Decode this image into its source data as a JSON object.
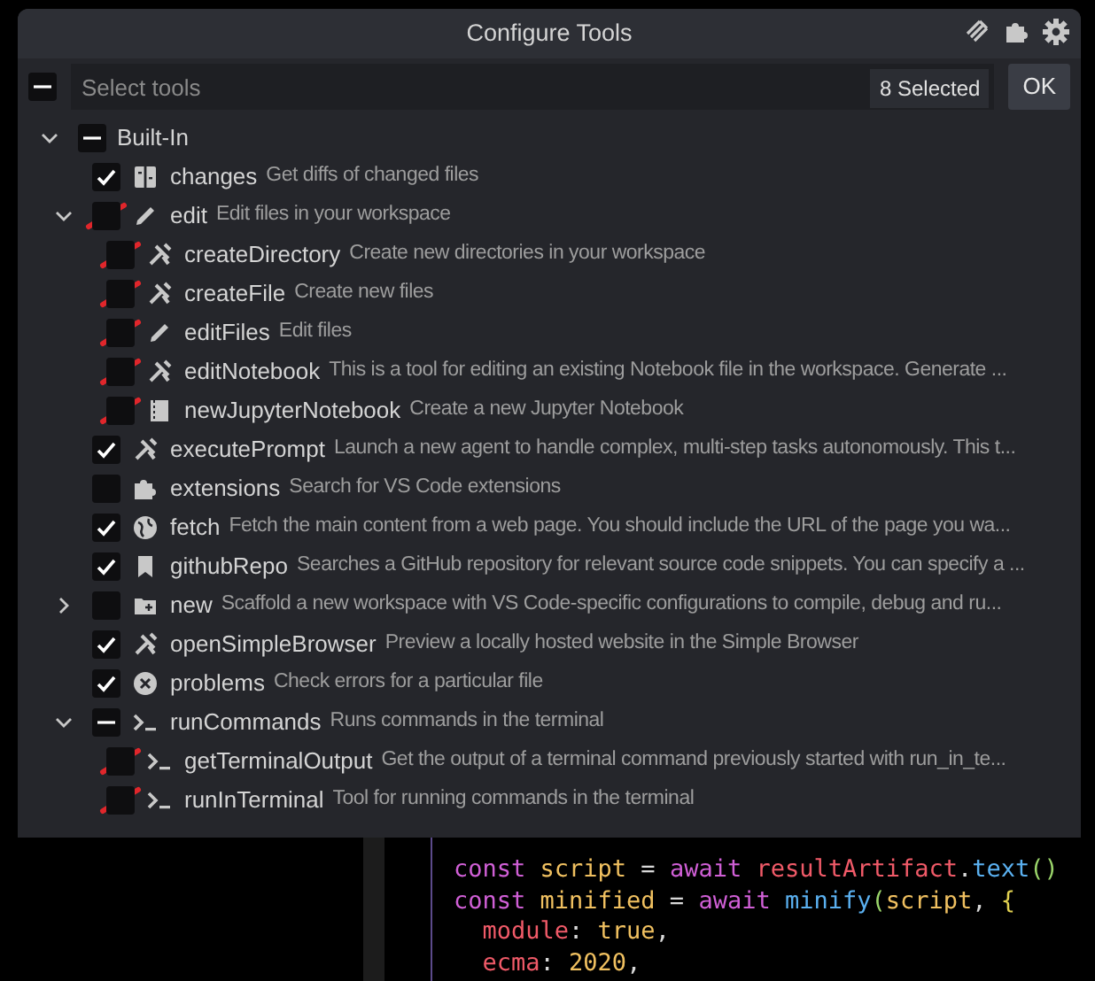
{
  "dialog": {
    "title": "Configure Tools",
    "search": {
      "placeholder": "Select tools",
      "mixed": true
    },
    "selected_count": "8 Selected",
    "ok_button": "OK",
    "tree": [
      {
        "name": "Built-In",
        "mixed": true,
        "expanded": true,
        "children": [
          {
            "name": "changes",
            "description": "Get diffs of changed files",
            "kind": "diff",
            "checked": true
          },
          {
            "name": "edit",
            "description": "Edit files in your workspace",
            "kind": "pencil",
            "checked": false,
            "annotated": true,
            "expanded": true,
            "children": [
              {
                "name": "createDirectory",
                "description": "Create new directories in your workspace",
                "kind": "tools",
                "checked": false,
                "annotated": true
              },
              {
                "name": "createFile",
                "description": "Create new files",
                "kind": "tools",
                "checked": false,
                "annotated": true
              },
              {
                "name": "editFiles",
                "description": "Edit files",
                "kind": "pencil",
                "checked": false,
                "annotated": true
              },
              {
                "name": "editNotebook",
                "description": "This is a tool for editing an existing Notebook file in the workspace. Generate ...",
                "kind": "tools",
                "checked": false,
                "annotated": true
              },
              {
                "name": "newJupyterNotebook",
                "description": "Create a new Jupyter Notebook",
                "kind": "notebook",
                "checked": false,
                "annotated": true
              }
            ]
          },
          {
            "name": "executePrompt",
            "description": "Launch a new agent to handle complex, multi-step tasks autonomously. This t...",
            "kind": "tools",
            "checked": true
          },
          {
            "name": "extensions",
            "description": "Search for VS Code extensions",
            "kind": "puzzle",
            "checked": false
          },
          {
            "name": "fetch",
            "description": "Fetch the main content from a web page. You should include the URL of the page you wa...",
            "kind": "globe",
            "checked": true
          },
          {
            "name": "githubRepo",
            "description": "Searches a GitHub repository for relevant source code snippets. You can specify a ...",
            "kind": "repo",
            "checked": true
          },
          {
            "name": "new",
            "description": "Scaffold a new workspace with VS Code-specific configurations to compile, debug and ru...",
            "kind": "folder",
            "checked": false,
            "expanded": false
          },
          {
            "name": "openSimpleBrowser",
            "description": "Preview a locally hosted website in the Simple Browser",
            "kind": "tools",
            "checked": true
          },
          {
            "name": "problems",
            "description": "Check errors for a particular file",
            "kind": "error",
            "checked": true
          },
          {
            "name": "runCommands",
            "description": "Runs commands in the terminal",
            "kind": "terminal",
            "mixed": true,
            "expanded": true,
            "children": [
              {
                "name": "getTerminalOutput",
                "description": "Get the output of a terminal command previously started with run_in_te...",
                "kind": "terminal",
                "checked": false,
                "annotated": true
              },
              {
                "name": "runInTerminal",
                "description": "Tool for running commands in the terminal",
                "kind": "terminal",
                "checked": false,
                "annotated": true
              }
            ]
          }
        ]
      }
    ]
  },
  "editor": {
    "lines": [
      [
        {
          "text": "const",
          "kind": "keyword"
        },
        {
          "text": " script",
          "kind": "variable"
        },
        {
          "text": " = ",
          "kind": "punct"
        },
        {
          "text": "await",
          "kind": "keyword"
        },
        {
          "text": " resultArtifact",
          "kind": "object"
        },
        {
          "text": ".",
          "kind": "punct"
        },
        {
          "text": "text",
          "kind": "function"
        },
        {
          "text": "()",
          "kind": "paren"
        }
      ],
      [
        {
          "text": "const",
          "kind": "keyword"
        },
        {
          "text": " minified",
          "kind": "variable"
        },
        {
          "text": " = ",
          "kind": "punct"
        },
        {
          "text": "await",
          "kind": "keyword"
        },
        {
          "text": " minify",
          "kind": "function"
        },
        {
          "text": "(",
          "kind": "paren"
        },
        {
          "text": "script",
          "kind": "variable"
        },
        {
          "text": ", ",
          "kind": "punct"
        },
        {
          "text": "{",
          "kind": "brace"
        }
      ],
      [
        {
          "text": "  module",
          "kind": "object"
        },
        {
          "text": ": ",
          "kind": "punct"
        },
        {
          "text": "true",
          "kind": "variable"
        },
        {
          "text": ",",
          "kind": "punct"
        }
      ],
      [
        {
          "text": "  ecma",
          "kind": "object"
        },
        {
          "text": ": ",
          "kind": "punct"
        },
        {
          "text": "2020",
          "kind": "variable"
        },
        {
          "text": ",",
          "kind": "punct"
        }
      ]
    ]
  }
}
